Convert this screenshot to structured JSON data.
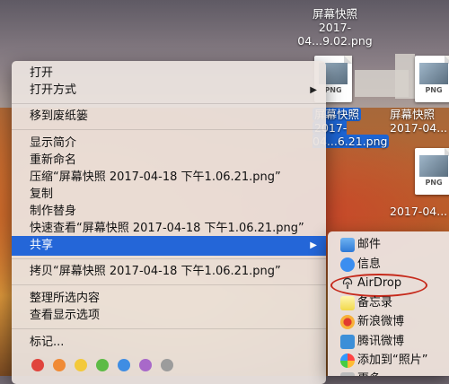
{
  "desktop": {
    "icons": [
      {
        "label_line1": "屏幕快照",
        "label_line2": "2017-04...9.02.png",
        "ext": "PNG"
      },
      {
        "label_line1": "屏幕快照",
        "label_line2": "2017-04...6.21.png",
        "ext": "PNG"
      },
      {
        "label_line1": "屏幕快照",
        "label_line2": "2017-04...",
        "ext": "PNG"
      },
      {
        "label_line1": "",
        "label_line2": "2017-04...",
        "ext": "PNG"
      }
    ]
  },
  "context_menu": {
    "items": [
      {
        "label": "打开"
      },
      {
        "label": "打开方式",
        "submenu_arrow": "▶"
      },
      {
        "label": "移到废纸篓"
      },
      {
        "label": "显示简介"
      },
      {
        "label": "重新命名"
      },
      {
        "label": "压缩“屏幕快照 2017-04-18 下午1.06.21.png”"
      },
      {
        "label": "复制"
      },
      {
        "label": "制作替身"
      },
      {
        "label": "快速查看“屏幕快照 2017-04-18 下午1.06.21.png”"
      },
      {
        "label": "共享",
        "submenu_arrow": "▶"
      },
      {
        "label": "拷贝“屏幕快照 2017-04-18 下午1.06.21.png”"
      },
      {
        "label": "整理所选内容"
      },
      {
        "label": "查看显示选项"
      },
      {
        "label": "标记..."
      }
    ],
    "tag_colors": [
      "#e0443d",
      "#f08a35",
      "#f3c93a",
      "#5dbb46",
      "#3f8de3",
      "#a869c9",
      "#9c9c9c"
    ]
  },
  "share_submenu": {
    "items": [
      {
        "label": "邮件",
        "icon": "mail-icon"
      },
      {
        "label": "信息",
        "icon": "messages-icon"
      },
      {
        "label": "AirDrop",
        "icon": "airdrop-icon"
      },
      {
        "label": "备忘录",
        "icon": "notes-icon"
      },
      {
        "label": "新浪微博",
        "icon": "weibo-icon"
      },
      {
        "label": "腾讯微博",
        "icon": "tencent-weibo-icon"
      },
      {
        "label": "添加到“照片”",
        "icon": "photos-icon"
      },
      {
        "label": "更多",
        "icon": "more-icon"
      }
    ],
    "highlight_color": "#c62a1c"
  },
  "colors": {
    "menu_highlight": "#2466d8"
  }
}
